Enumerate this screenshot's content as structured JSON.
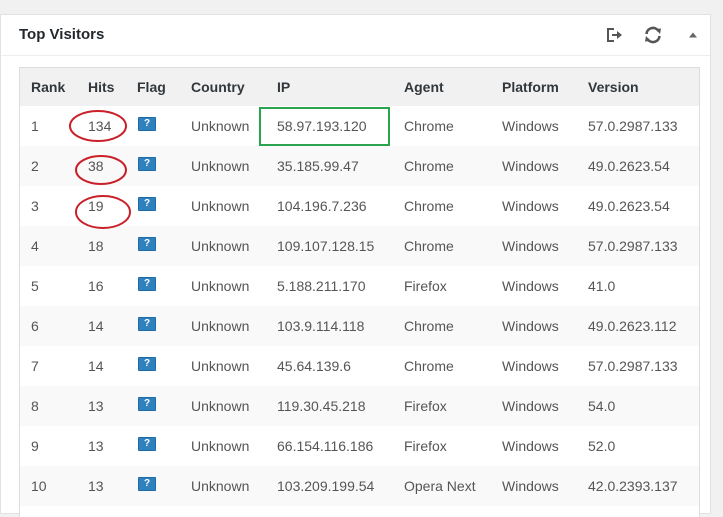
{
  "widget": {
    "title": "Top Visitors",
    "icons": [
      "export-icon",
      "refresh-icon",
      "collapse-arrow-icon"
    ]
  },
  "table": {
    "headers": {
      "rank": "Rank",
      "hits": "Hits",
      "flag": "Flag",
      "country": "Country",
      "ip": "IP",
      "agent": "Agent",
      "platform": "Platform",
      "version": "Version"
    },
    "rows": [
      {
        "rank": "1",
        "hits": "134",
        "country": "Unknown",
        "ip": "58.97.193.120",
        "agent": "Chrome",
        "platform": "Windows",
        "version": "57.0.2987.133"
      },
      {
        "rank": "2",
        "hits": "38",
        "country": "Unknown",
        "ip": "35.185.99.47",
        "agent": "Chrome",
        "platform": "Windows",
        "version": "49.0.2623.54"
      },
      {
        "rank": "3",
        "hits": "19",
        "country": "Unknown",
        "ip": "104.196.7.236",
        "agent": "Chrome",
        "platform": "Windows",
        "version": "49.0.2623.54"
      },
      {
        "rank": "4",
        "hits": "18",
        "country": "Unknown",
        "ip": "109.107.128.15",
        "agent": "Chrome",
        "platform": "Windows",
        "version": "57.0.2987.133"
      },
      {
        "rank": "5",
        "hits": "16",
        "country": "Unknown",
        "ip": "5.188.211.170",
        "agent": "Firefox",
        "platform": "Windows",
        "version": "41.0"
      },
      {
        "rank": "6",
        "hits": "14",
        "country": "Unknown",
        "ip": "103.9.114.118",
        "agent": "Chrome",
        "platform": "Windows",
        "version": "49.0.2623.112"
      },
      {
        "rank": "7",
        "hits": "14",
        "country": "Unknown",
        "ip": "45.64.139.6",
        "agent": "Chrome",
        "platform": "Windows",
        "version": "57.0.2987.133"
      },
      {
        "rank": "8",
        "hits": "13",
        "country": "Unknown",
        "ip": "119.30.45.218",
        "agent": "Firefox",
        "platform": "Windows",
        "version": "54.0"
      },
      {
        "rank": "9",
        "hits": "13",
        "country": "Unknown",
        "ip": "66.154.116.186",
        "agent": "Firefox",
        "platform": "Windows",
        "version": "52.0"
      },
      {
        "rank": "10",
        "hits": "13",
        "country": "Unknown",
        "ip": "103.209.199.54",
        "agent": "Opera Next",
        "platform": "Windows",
        "version": "42.0.2393.137"
      }
    ],
    "flag_glyph": "?"
  },
  "annotations": {
    "circle_color": "#c9202a",
    "box_color": "#2aa44f"
  }
}
